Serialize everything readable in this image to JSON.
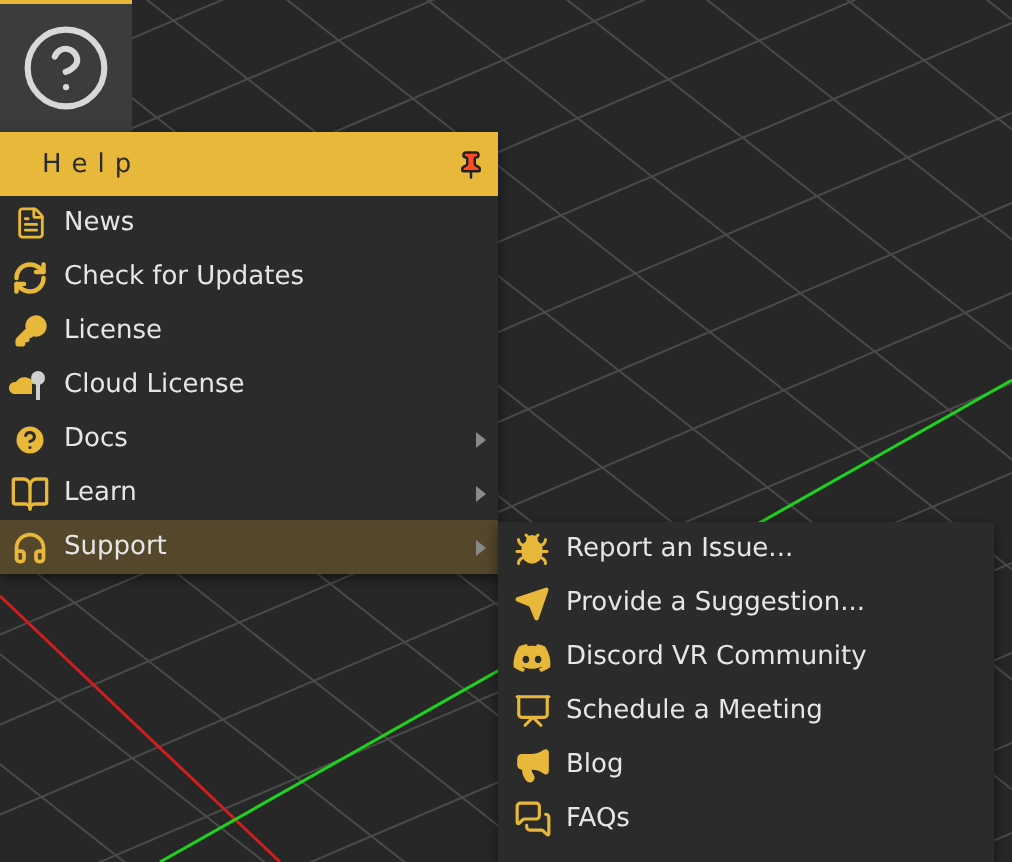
{
  "help_menu": {
    "title": "Help",
    "items": [
      {
        "label": "News",
        "selected": false,
        "has_submenu": false
      },
      {
        "label": "Check for Updates",
        "selected": false,
        "has_submenu": false
      },
      {
        "label": "License",
        "selected": false,
        "has_submenu": false
      },
      {
        "label": "Cloud License",
        "selected": false,
        "has_submenu": false
      },
      {
        "label": "Docs",
        "selected": false,
        "has_submenu": true
      },
      {
        "label": "Learn",
        "selected": false,
        "has_submenu": true
      },
      {
        "label": "Support",
        "selected": true,
        "has_submenu": true
      }
    ]
  },
  "support_submenu": {
    "items": [
      {
        "label": "Report an Issue..."
      },
      {
        "label": "Provide a Suggestion..."
      },
      {
        "label": "Discord VR Community"
      },
      {
        "label": "Schedule a Meeting"
      },
      {
        "label": "Blog"
      },
      {
        "label": "FAQs"
      }
    ]
  }
}
